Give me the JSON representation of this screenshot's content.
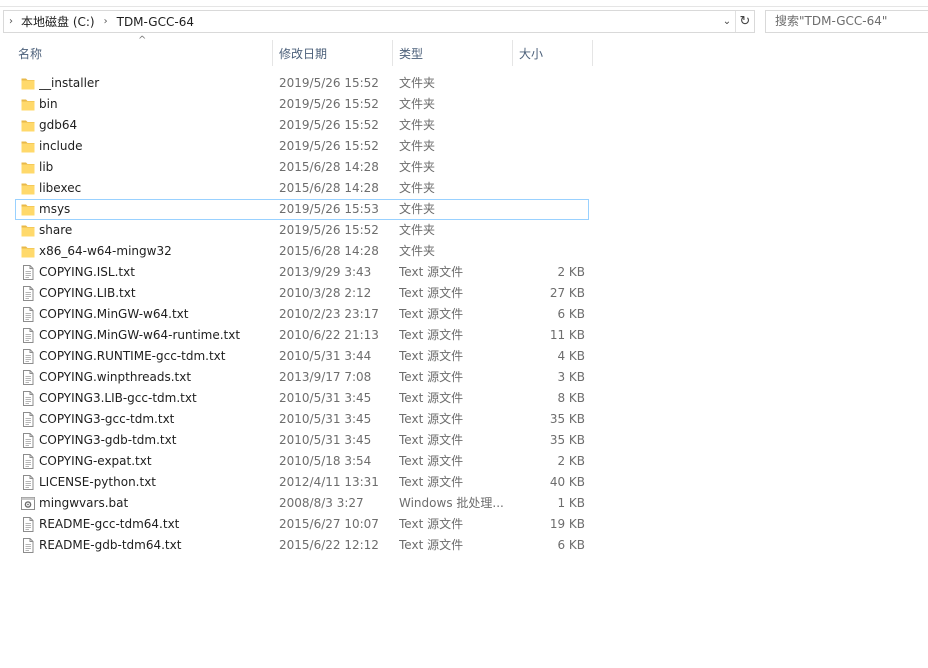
{
  "address": {
    "crumbs": [
      "本地磁盘 (C:)",
      "TDM-GCC-64"
    ]
  },
  "search": {
    "placeholder": "搜索\"TDM-GCC-64\""
  },
  "columns": {
    "name": "名称",
    "date": "修改日期",
    "type": "类型",
    "size": "大小"
  },
  "colors": {
    "folder": "#ffd96b",
    "header_text": "#4c607a",
    "selection_border": "#99d1ff"
  },
  "files": [
    {
      "name": "__installer",
      "date": "2019/5/26 15:52",
      "type": "文件夹",
      "size": "",
      "icon": "folder-icon"
    },
    {
      "name": "bin",
      "date": "2019/5/26 15:52",
      "type": "文件夹",
      "size": "",
      "icon": "folder-icon"
    },
    {
      "name": "gdb64",
      "date": "2019/5/26 15:52",
      "type": "文件夹",
      "size": "",
      "icon": "folder-icon"
    },
    {
      "name": "include",
      "date": "2019/5/26 15:52",
      "type": "文件夹",
      "size": "",
      "icon": "folder-icon"
    },
    {
      "name": "lib",
      "date": "2015/6/28 14:28",
      "type": "文件夹",
      "size": "",
      "icon": "folder-icon"
    },
    {
      "name": "libexec",
      "date": "2015/6/28 14:28",
      "type": "文件夹",
      "size": "",
      "icon": "folder-icon"
    },
    {
      "name": "msys",
      "date": "2019/5/26 15:53",
      "type": "文件夹",
      "size": "",
      "icon": "folder-icon",
      "selected": true
    },
    {
      "name": "share",
      "date": "2019/5/26 15:52",
      "type": "文件夹",
      "size": "",
      "icon": "folder-icon"
    },
    {
      "name": "x86_64-w64-mingw32",
      "date": "2015/6/28 14:28",
      "type": "文件夹",
      "size": "",
      "icon": "folder-icon"
    },
    {
      "name": "COPYING.ISL.txt",
      "date": "2013/9/29 3:43",
      "type": "Text 源文件",
      "size": "2 KB",
      "icon": "text-file-icon"
    },
    {
      "name": "COPYING.LIB.txt",
      "date": "2010/3/28 2:12",
      "type": "Text 源文件",
      "size": "27 KB",
      "icon": "text-file-icon"
    },
    {
      "name": "COPYING.MinGW-w64.txt",
      "date": "2010/2/23 23:17",
      "type": "Text 源文件",
      "size": "6 KB",
      "icon": "text-file-icon"
    },
    {
      "name": "COPYING.MinGW-w64-runtime.txt",
      "date": "2010/6/22 21:13",
      "type": "Text 源文件",
      "size": "11 KB",
      "icon": "text-file-icon"
    },
    {
      "name": "COPYING.RUNTIME-gcc-tdm.txt",
      "date": "2010/5/31 3:44",
      "type": "Text 源文件",
      "size": "4 KB",
      "icon": "text-file-icon"
    },
    {
      "name": "COPYING.winpthreads.txt",
      "date": "2013/9/17 7:08",
      "type": "Text 源文件",
      "size": "3 KB",
      "icon": "text-file-icon"
    },
    {
      "name": "COPYING3.LIB-gcc-tdm.txt",
      "date": "2010/5/31 3:45",
      "type": "Text 源文件",
      "size": "8 KB",
      "icon": "text-file-icon"
    },
    {
      "name": "COPYING3-gcc-tdm.txt",
      "date": "2010/5/31 3:45",
      "type": "Text 源文件",
      "size": "35 KB",
      "icon": "text-file-icon"
    },
    {
      "name": "COPYING3-gdb-tdm.txt",
      "date": "2010/5/31 3:45",
      "type": "Text 源文件",
      "size": "35 KB",
      "icon": "text-file-icon"
    },
    {
      "name": "COPYING-expat.txt",
      "date": "2010/5/18 3:54",
      "type": "Text 源文件",
      "size": "2 KB",
      "icon": "text-file-icon"
    },
    {
      "name": "LICENSE-python.txt",
      "date": "2012/4/11 13:31",
      "type": "Text 源文件",
      "size": "40 KB",
      "icon": "text-file-icon"
    },
    {
      "name": "mingwvars.bat",
      "date": "2008/8/3 3:27",
      "type": "Windows 批处理...",
      "size": "1 KB",
      "icon": "batch-file-icon"
    },
    {
      "name": "README-gcc-tdm64.txt",
      "date": "2015/6/27 10:07",
      "type": "Text 源文件",
      "size": "19 KB",
      "icon": "text-file-icon"
    },
    {
      "name": "README-gdb-tdm64.txt",
      "date": "2015/6/22 12:12",
      "type": "Text 源文件",
      "size": "6 KB",
      "icon": "text-file-icon"
    }
  ]
}
